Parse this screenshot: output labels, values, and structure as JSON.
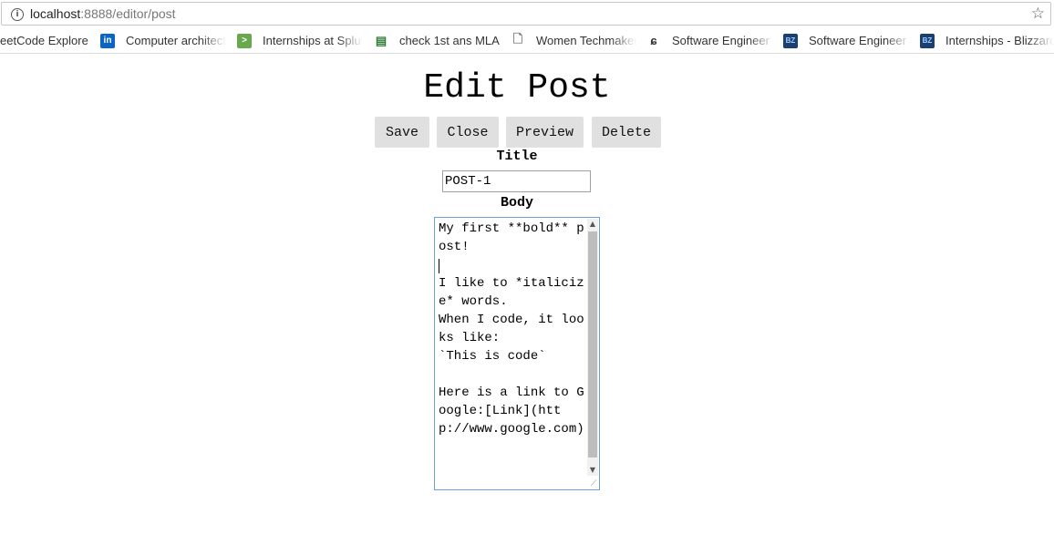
{
  "browser": {
    "url_host": "localhost",
    "url_path": ":8888/editor/post",
    "info_icon": "info-icon",
    "star_icon": "star-icon"
  },
  "bookmarks": [
    {
      "label": "eetCode Explore",
      "icon": "none"
    },
    {
      "label": "Computer architect",
      "icon": "linkedin-icon"
    },
    {
      "label": "Internships at Splu",
      "icon": "terminal-icon"
    },
    {
      "label": "check 1st ans MLA",
      "icon": "grid-icon"
    },
    {
      "label": "Women Techmakers",
      "icon": "page-icon"
    },
    {
      "label": "Software Engineer",
      "icon": "swirl-icon"
    },
    {
      "label": "Software Engineer",
      "icon": "blizzard-icon"
    },
    {
      "label": "Internships - Blizzard",
      "icon": "blizzard-icon"
    }
  ],
  "page": {
    "title": "Edit Post",
    "buttons": {
      "save": "Save",
      "close": "Close",
      "preview": "Preview",
      "delete": "Delete"
    },
    "title_label": "Title",
    "title_value": "POST-1",
    "body_label": "Body",
    "body_value": "My first **bold** post!\n\nI like to *italicize* words.\nWhen I code, it looks like:\n`This is code`\n\nHere is a link to Google:[Link](http://www.google.com)"
  },
  "colors": {
    "button_bg": "#e0e0e0",
    "focus_border": "#6f9fd8",
    "linkedin": "#0a66c2",
    "terminal": "#6aa84f",
    "blizzard": "#1b3f73"
  }
}
